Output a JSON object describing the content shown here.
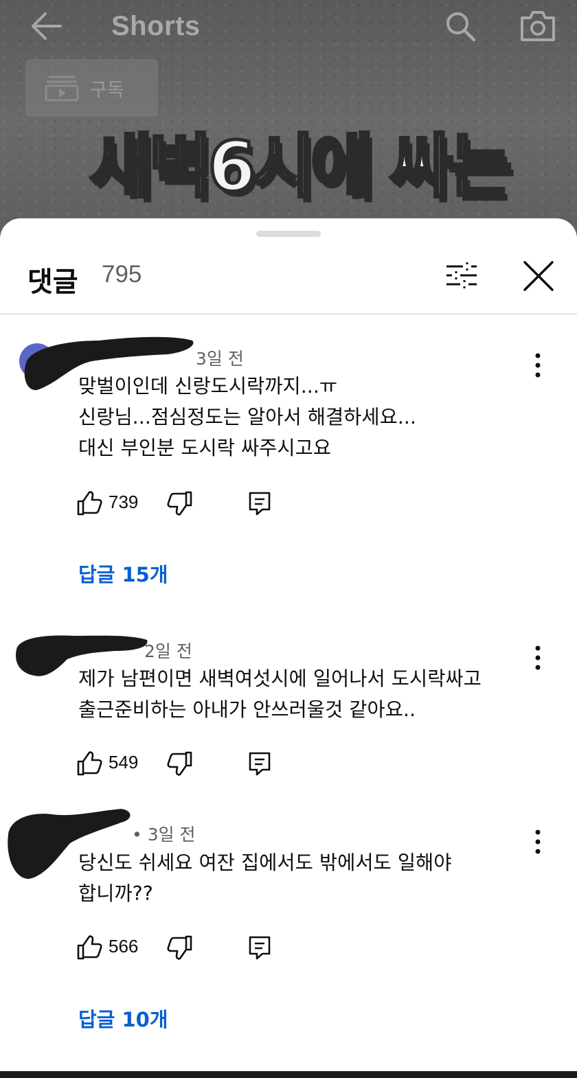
{
  "topbar": {
    "title": "Shorts",
    "back_icon": "arrow-left-icon",
    "search_icon": "search-icon",
    "camera_icon": "camera-icon"
  },
  "video": {
    "subscribe_label": "구독",
    "caption": "새벽6시에 싸는"
  },
  "sheet": {
    "title": "댓글",
    "count": "795",
    "filter_icon": "sliders-icon",
    "close_icon": "close-icon"
  },
  "comments": [
    {
      "time": "3일 전",
      "lines": [
        "맞벌이인데 신랑도시락까지...ㅠ",
        "신랑님...점심정도는 알아서 해결하세요...",
        "대신 부인분 도시락 싸주시고요"
      ],
      "likes": "739",
      "replies": "답글 15개"
    },
    {
      "time": "2일 전",
      "lines": [
        "제가 남편이면 새벽여섯시에 일어나서 도시락싸고",
        "출근준비하는 아내가 안쓰러울것 같아요.."
      ],
      "likes": "549",
      "replies": ""
    },
    {
      "time": "• 3일 전",
      "lines": [
        "당신도  쉬세요  여잔 집에서도 밖에서도 일해야",
        "합니까??"
      ],
      "likes": "566",
      "replies": "답글 10개"
    }
  ],
  "colors": {
    "link": "#065fd4",
    "secondary_text": "#606060",
    "redaction": "#1a1a1a"
  }
}
